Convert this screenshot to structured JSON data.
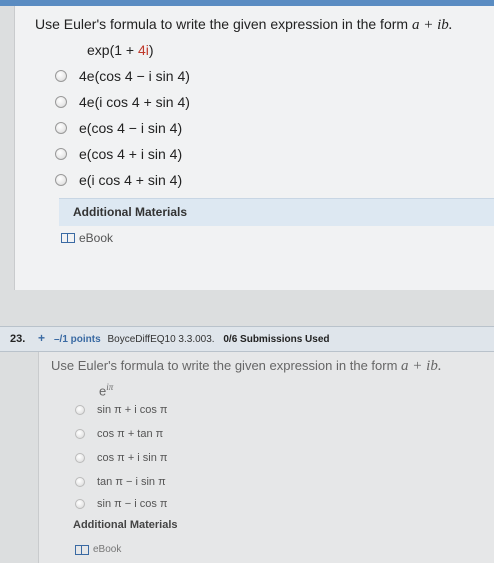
{
  "q22": {
    "prompt_main": "Use Euler's formula to write the given expression in the form ",
    "prompt_form": "a + ib.",
    "expression_prefix": "exp(1 + ",
    "expression_em": "4i",
    "expression_suffix": ")",
    "options": [
      "4e(cos 4 − i sin 4)",
      "4e(i cos 4 + sin 4)",
      "e(cos 4 − i sin 4)",
      "e(cos 4 + i sin 4)",
      "e(i cos 4 + sin 4)"
    ],
    "additional_materials": "Additional Materials",
    "ebook": "eBook"
  },
  "q23": {
    "number": "23.",
    "points": "–/1 points",
    "code": "BoyceDiffEQ10 3.3.003.",
    "submissions": "0/6 Submissions Used",
    "prompt_main": "Use Euler's formula to write the given expression in the form ",
    "prompt_form": "a + ib.",
    "expression": "e^(iπ)",
    "expression_base": "e",
    "expression_exp": "iπ",
    "options": [
      "sin π + i cos π",
      "cos π + tan π",
      "cos π + i sin π",
      "tan π − i sin π",
      "sin π − i cos π"
    ],
    "additional_materials": "Additional Materials",
    "ebook": "eBook"
  },
  "colors": {
    "accent_blue": "#3a6aa3",
    "expression_highlight": "#c0392b"
  },
  "icons": [
    "radio-button-icon",
    "book-icon",
    "plus-icon"
  ]
}
